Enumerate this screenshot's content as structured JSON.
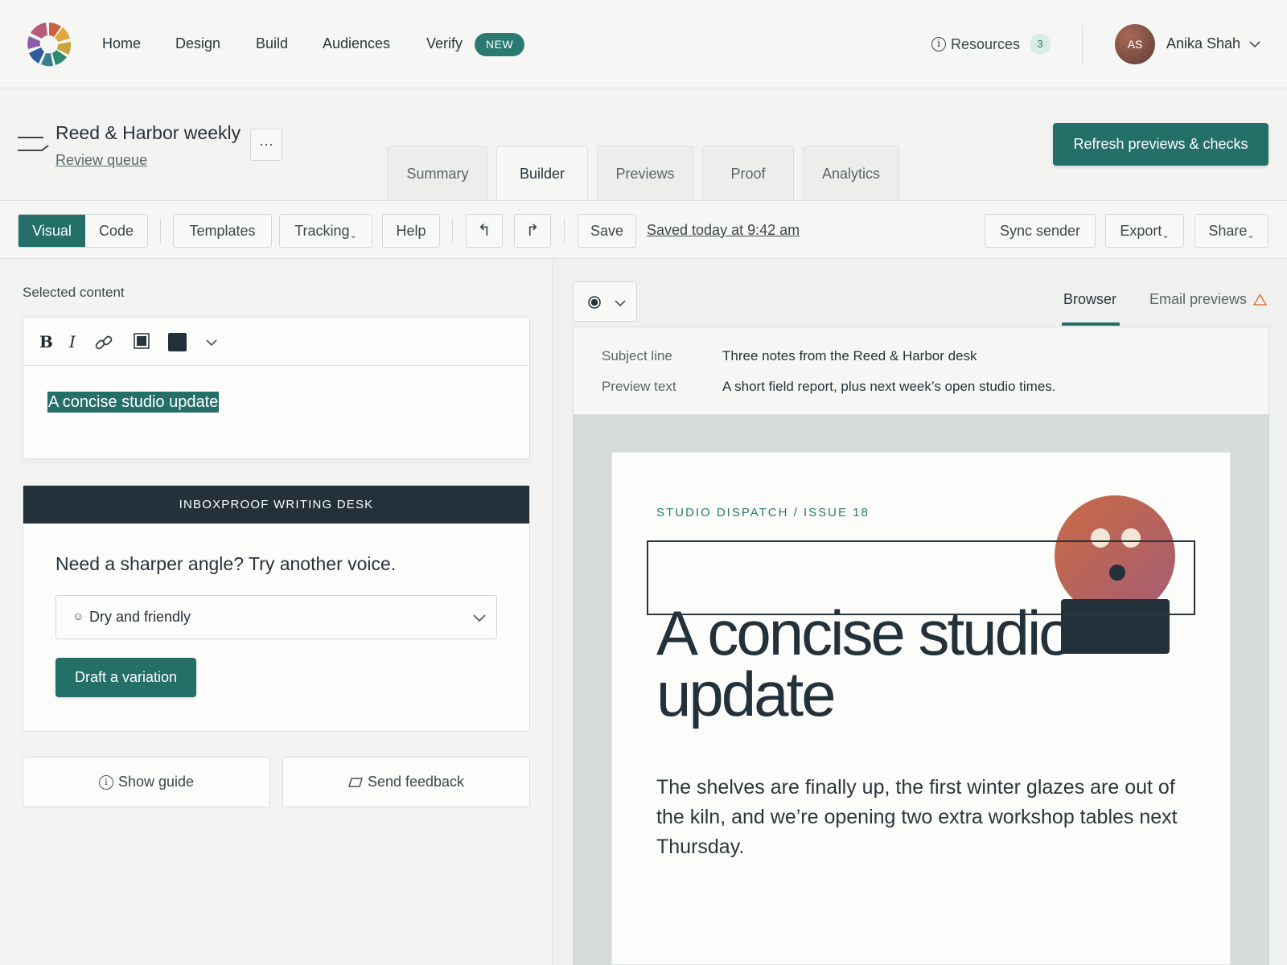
{
  "nav": {
    "items": [
      "Home",
      "Design",
      "Build",
      "Audiences",
      "Verify"
    ],
    "verify_badge": "NEW",
    "resources_label": "Resources",
    "resources_count": "3",
    "avatar_initials": "AS",
    "user_name": "Anika Shah"
  },
  "doc": {
    "title": "Reed & Harbor weekly",
    "subtitle": "Review queue",
    "more_label": "···",
    "primary_action": "Refresh previews & checks",
    "tabs": [
      "Summary",
      "Builder",
      "Previews",
      "Proof",
      "Analytics"
    ],
    "active_tab": "Builder"
  },
  "toolbar": {
    "mode_visual": "Visual",
    "mode_code": "Code",
    "templates": "Templates",
    "tracking": "Tracking",
    "help": "Help",
    "undo_icon": "↰",
    "redo_icon": "↱",
    "save": "Save",
    "saved_status": "Saved today at 9:42 am",
    "sync_sender": "Sync sender",
    "export": "Export",
    "share": "Share"
  },
  "editor": {
    "section_label": "Selected content",
    "bold": "B",
    "italic": "I",
    "selected_text": "A concise studio update"
  },
  "writing_desk": {
    "header": "INBOXPROOF WRITING DESK",
    "prompt": "Need a sharper angle? Try another voice.",
    "voice_selected": "Dry and friendly",
    "draft_button": "Draft a variation"
  },
  "footer_actions": {
    "show_guide": "Show guide",
    "send_feedback": "Send feedback"
  },
  "preview": {
    "view_browser": "Browser",
    "view_email": "Email previews",
    "subject_label": "Subject line",
    "subject_value": "Three notes from the Reed & Harbor desk",
    "preview_label": "Preview text",
    "preview_value": "A short field report, plus next week’s open studio times."
  },
  "email": {
    "kicker": "STUDIO DISPATCH / ISSUE 18",
    "headline_line1": "A concise studio",
    "headline_line2": "update",
    "body": "The shelves are finally up, the first winter glazes are out of the kiln, and we’re opening two extra workshop tables next Thursday."
  },
  "colors": {
    "accent": "#246f68",
    "dark": "#22313a",
    "warning": "#d77a4a"
  }
}
